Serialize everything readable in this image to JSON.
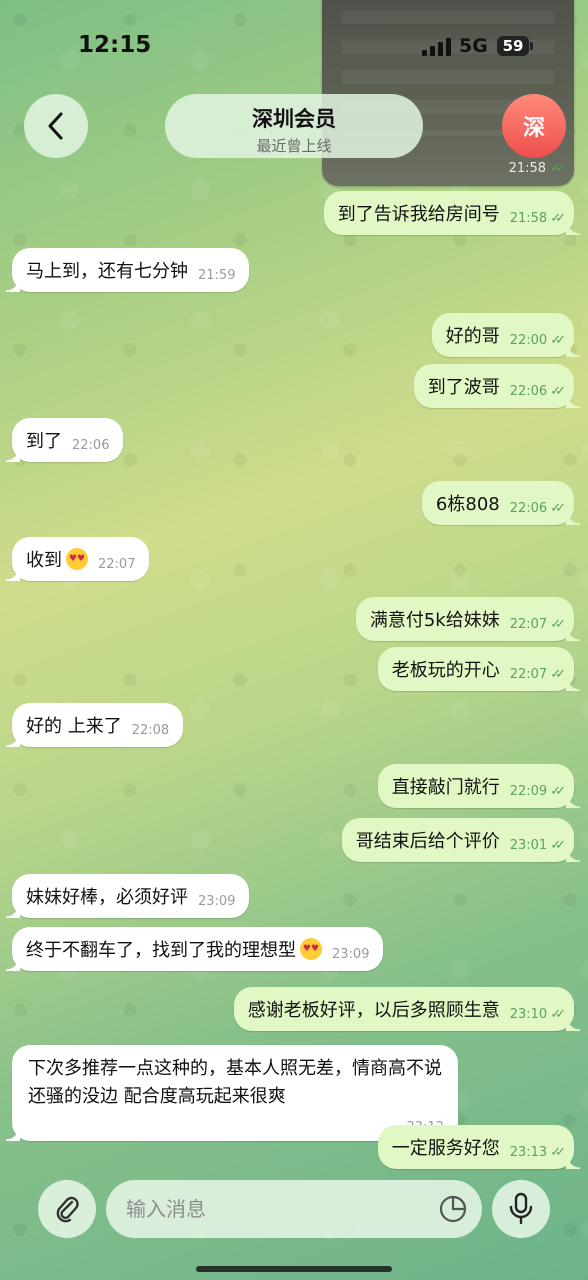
{
  "status": {
    "time": "12:15",
    "network": "5G",
    "battery": "59"
  },
  "header": {
    "title": "深圳会员",
    "subtitle": "最近曾上线",
    "avatar_letter": "深"
  },
  "preview": {
    "time": "21:58"
  },
  "input": {
    "placeholder": "输入消息"
  },
  "messages": [
    {
      "dir": "out",
      "text": "到了告诉我给房间号",
      "time": "21:58"
    },
    {
      "dir": "in",
      "text": "马上到，还有七分钟",
      "time": "21:59"
    },
    {
      "dir": "out",
      "text": "好的哥",
      "time": "22:00"
    },
    {
      "dir": "out",
      "text": "到了波哥",
      "time": "22:06"
    },
    {
      "dir": "in",
      "text": "到了",
      "time": "22:06"
    },
    {
      "dir": "out",
      "text": "6栋808",
      "time": "22:06"
    },
    {
      "dir": "in",
      "text": "收到",
      "emoji": "heart-eyes",
      "time": "22:07"
    },
    {
      "dir": "out",
      "text": "满意付5k给妹妹",
      "time": "22:07"
    },
    {
      "dir": "out",
      "text": "老板玩的开心",
      "time": "22:07"
    },
    {
      "dir": "in",
      "text": "好的 上来了",
      "time": "22:08"
    },
    {
      "dir": "out",
      "text": "直接敲门就行",
      "time": "22:09"
    },
    {
      "dir": "out",
      "text": "哥结束后给个评价",
      "time": "23:01"
    },
    {
      "dir": "in",
      "text": "妹妹好棒，必须好评",
      "time": "23:09"
    },
    {
      "dir": "in",
      "text": "终于不翻车了，找到了我的理想型",
      "emoji": "heart-eyes",
      "time": "23:09"
    },
    {
      "dir": "out",
      "text": "感谢老板好评，以后多照顾生意",
      "time": "23:10"
    },
    {
      "dir": "in",
      "lines": [
        "下次多推荐一点这种的，基本人照无差，情商高不说",
        "还骚的没边 配合度高玩起来很爽"
      ],
      "time": "23:12"
    },
    {
      "dir": "out",
      "text": "一定服务好您",
      "time": "23:13"
    }
  ]
}
